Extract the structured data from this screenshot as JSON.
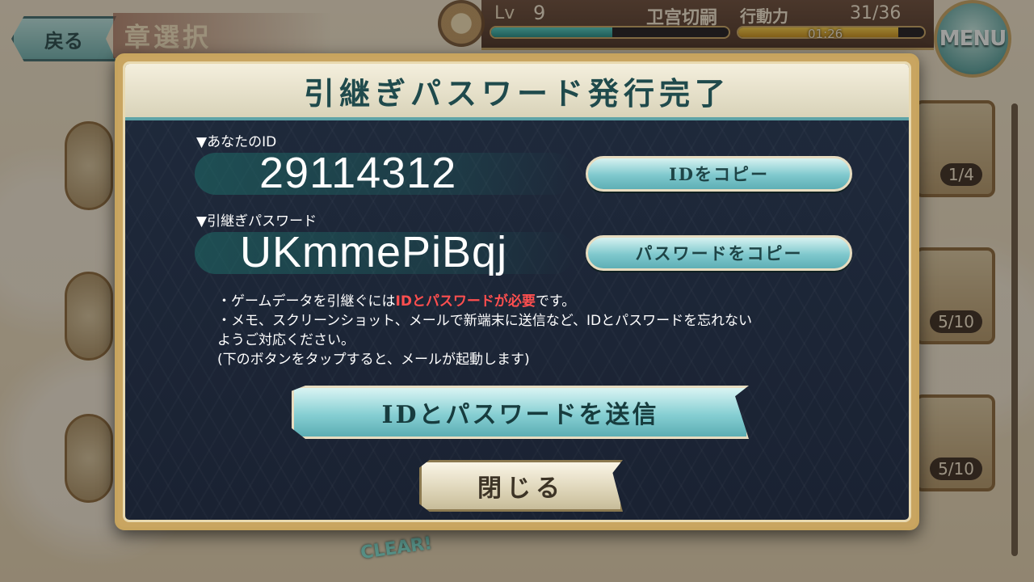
{
  "topbar": {
    "back_label": "戻る",
    "chapter_title": "章選択",
    "level_label": "Lv",
    "level_value": "9",
    "player_name": "卫宫切嗣",
    "exp_progress": 0.51,
    "stamina_label": "行動力",
    "stamina_value": "31/36",
    "stamina_progress": 0.86,
    "stamina_timer": "01:26",
    "menu_label": "MENU"
  },
  "side_cards": [
    {
      "count": "1/4"
    },
    {
      "count": "5/10"
    },
    {
      "count": "5/10"
    }
  ],
  "clear_badge": "CLEAR!",
  "dialog": {
    "title": "引継ぎパスワード発行完了",
    "id_label": "▼あなたのID",
    "id_value": "29114312",
    "copy_id_label": "IDをコピー",
    "password_label": "▼引継ぎパスワード",
    "password_value": "UKmmePiBqj",
    "copy_password_label": "パスワードをコピー",
    "notice": {
      "line1_prefix": "・ゲームデータを引継ぐには",
      "line1_highlight": "IDとパスワードが必要",
      "line1_suffix": "です。",
      "line2": "・メモ、スクリーンショット、メールで新端末に送信など、IDとパスワードを忘れない",
      "line3": "ようご対応ください。",
      "line4": "(下のボタンをタップすると、メールが起動します)"
    },
    "send_label": "IDとパスワードを送信",
    "close_label": "閉じる"
  },
  "colors": {
    "accent_teal": "#5eafb5",
    "highlight_red": "#ff4f4f",
    "dialog_bg": "#1f2a3c",
    "frame_gold": "#c7a45e"
  }
}
